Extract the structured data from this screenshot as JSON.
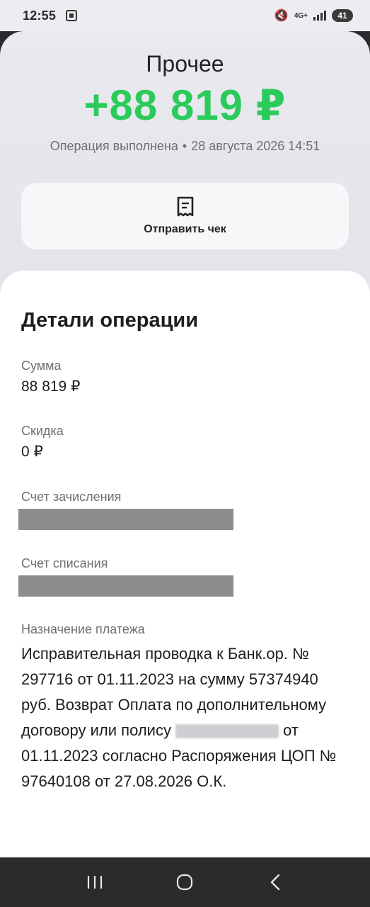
{
  "status_bar": {
    "time": "12:55",
    "network": "4G+",
    "battery": "41"
  },
  "header": {
    "category": "Прочее",
    "amount": "+88 819 ₽",
    "status": "Операция выполнена",
    "datetime": "28 августа 2026 14:51",
    "amount_color": "#2bcb5a"
  },
  "receipt": {
    "label": "Отправить чек"
  },
  "details": {
    "title": "Детали операции",
    "sum": {
      "label": "Сумма",
      "value": "88 819 ₽"
    },
    "discount": {
      "label": "Скидка",
      "value": "0 ₽"
    },
    "credit_account": {
      "label": "Счет зачисления"
    },
    "debit_account": {
      "label": "Счет списания"
    },
    "purpose": {
      "label": "Назначение платежа",
      "text_before": "Исправительная проводка к Банк.ор. № 297716 от 01.11.2023 на сумму 57374940 руб. Возврат Оплата по дополнительному договору или полису ",
      "text_after": " от 01.11.2023 согласно Распоряжения ЦОП № 97640108 от 27.08.2026 О.К."
    }
  },
  "nav_icons": [
    "recent-apps-icon",
    "home-icon",
    "back-icon"
  ]
}
